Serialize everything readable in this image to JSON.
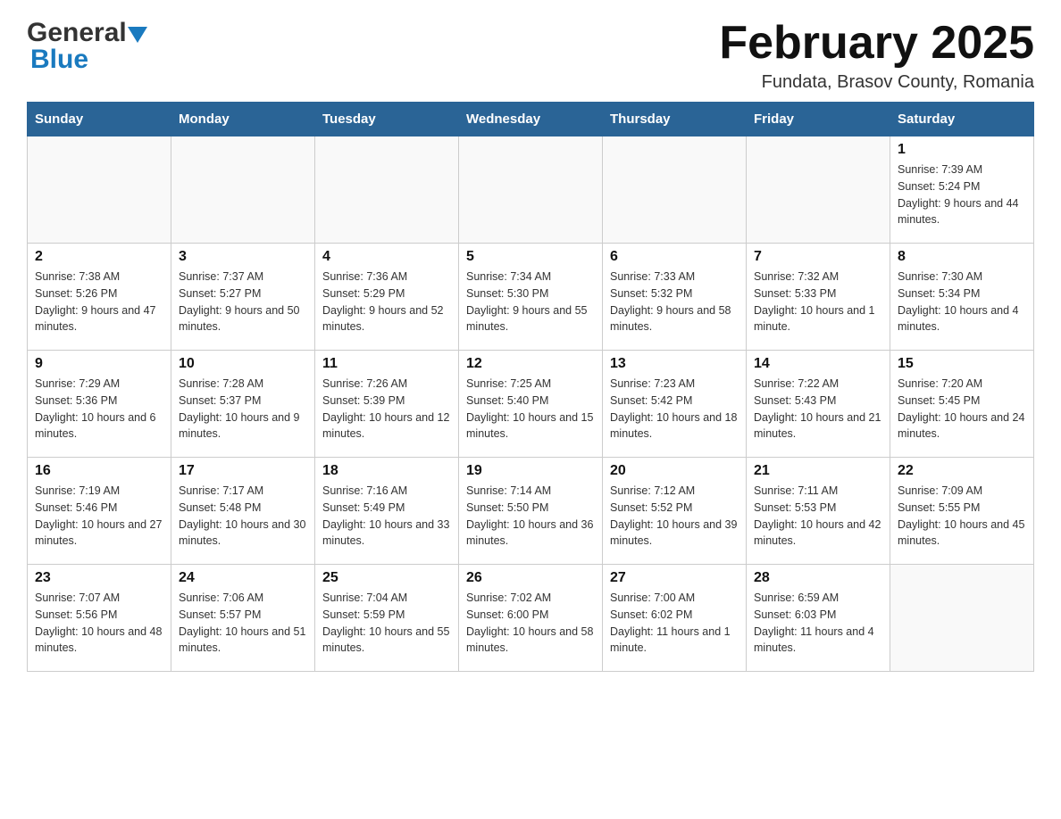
{
  "header": {
    "logo_general": "General",
    "logo_blue": "Blue",
    "month_title": "February 2025",
    "location": "Fundata, Brasov County, Romania"
  },
  "days_of_week": [
    "Sunday",
    "Monday",
    "Tuesday",
    "Wednesday",
    "Thursday",
    "Friday",
    "Saturday"
  ],
  "weeks": [
    [
      {
        "day": "",
        "info": ""
      },
      {
        "day": "",
        "info": ""
      },
      {
        "day": "",
        "info": ""
      },
      {
        "day": "",
        "info": ""
      },
      {
        "day": "",
        "info": ""
      },
      {
        "day": "",
        "info": ""
      },
      {
        "day": "1",
        "info": "Sunrise: 7:39 AM\nSunset: 5:24 PM\nDaylight: 9 hours and 44 minutes."
      }
    ],
    [
      {
        "day": "2",
        "info": "Sunrise: 7:38 AM\nSunset: 5:26 PM\nDaylight: 9 hours and 47 minutes."
      },
      {
        "day": "3",
        "info": "Sunrise: 7:37 AM\nSunset: 5:27 PM\nDaylight: 9 hours and 50 minutes."
      },
      {
        "day": "4",
        "info": "Sunrise: 7:36 AM\nSunset: 5:29 PM\nDaylight: 9 hours and 52 minutes."
      },
      {
        "day": "5",
        "info": "Sunrise: 7:34 AM\nSunset: 5:30 PM\nDaylight: 9 hours and 55 minutes."
      },
      {
        "day": "6",
        "info": "Sunrise: 7:33 AM\nSunset: 5:32 PM\nDaylight: 9 hours and 58 minutes."
      },
      {
        "day": "7",
        "info": "Sunrise: 7:32 AM\nSunset: 5:33 PM\nDaylight: 10 hours and 1 minute."
      },
      {
        "day": "8",
        "info": "Sunrise: 7:30 AM\nSunset: 5:34 PM\nDaylight: 10 hours and 4 minutes."
      }
    ],
    [
      {
        "day": "9",
        "info": "Sunrise: 7:29 AM\nSunset: 5:36 PM\nDaylight: 10 hours and 6 minutes."
      },
      {
        "day": "10",
        "info": "Sunrise: 7:28 AM\nSunset: 5:37 PM\nDaylight: 10 hours and 9 minutes."
      },
      {
        "day": "11",
        "info": "Sunrise: 7:26 AM\nSunset: 5:39 PM\nDaylight: 10 hours and 12 minutes."
      },
      {
        "day": "12",
        "info": "Sunrise: 7:25 AM\nSunset: 5:40 PM\nDaylight: 10 hours and 15 minutes."
      },
      {
        "day": "13",
        "info": "Sunrise: 7:23 AM\nSunset: 5:42 PM\nDaylight: 10 hours and 18 minutes."
      },
      {
        "day": "14",
        "info": "Sunrise: 7:22 AM\nSunset: 5:43 PM\nDaylight: 10 hours and 21 minutes."
      },
      {
        "day": "15",
        "info": "Sunrise: 7:20 AM\nSunset: 5:45 PM\nDaylight: 10 hours and 24 minutes."
      }
    ],
    [
      {
        "day": "16",
        "info": "Sunrise: 7:19 AM\nSunset: 5:46 PM\nDaylight: 10 hours and 27 minutes."
      },
      {
        "day": "17",
        "info": "Sunrise: 7:17 AM\nSunset: 5:48 PM\nDaylight: 10 hours and 30 minutes."
      },
      {
        "day": "18",
        "info": "Sunrise: 7:16 AM\nSunset: 5:49 PM\nDaylight: 10 hours and 33 minutes."
      },
      {
        "day": "19",
        "info": "Sunrise: 7:14 AM\nSunset: 5:50 PM\nDaylight: 10 hours and 36 minutes."
      },
      {
        "day": "20",
        "info": "Sunrise: 7:12 AM\nSunset: 5:52 PM\nDaylight: 10 hours and 39 minutes."
      },
      {
        "day": "21",
        "info": "Sunrise: 7:11 AM\nSunset: 5:53 PM\nDaylight: 10 hours and 42 minutes."
      },
      {
        "day": "22",
        "info": "Sunrise: 7:09 AM\nSunset: 5:55 PM\nDaylight: 10 hours and 45 minutes."
      }
    ],
    [
      {
        "day": "23",
        "info": "Sunrise: 7:07 AM\nSunset: 5:56 PM\nDaylight: 10 hours and 48 minutes."
      },
      {
        "day": "24",
        "info": "Sunrise: 7:06 AM\nSunset: 5:57 PM\nDaylight: 10 hours and 51 minutes."
      },
      {
        "day": "25",
        "info": "Sunrise: 7:04 AM\nSunset: 5:59 PM\nDaylight: 10 hours and 55 minutes."
      },
      {
        "day": "26",
        "info": "Sunrise: 7:02 AM\nSunset: 6:00 PM\nDaylight: 10 hours and 58 minutes."
      },
      {
        "day": "27",
        "info": "Sunrise: 7:00 AM\nSunset: 6:02 PM\nDaylight: 11 hours and 1 minute."
      },
      {
        "day": "28",
        "info": "Sunrise: 6:59 AM\nSunset: 6:03 PM\nDaylight: 11 hours and 4 minutes."
      },
      {
        "day": "",
        "info": ""
      }
    ]
  ]
}
